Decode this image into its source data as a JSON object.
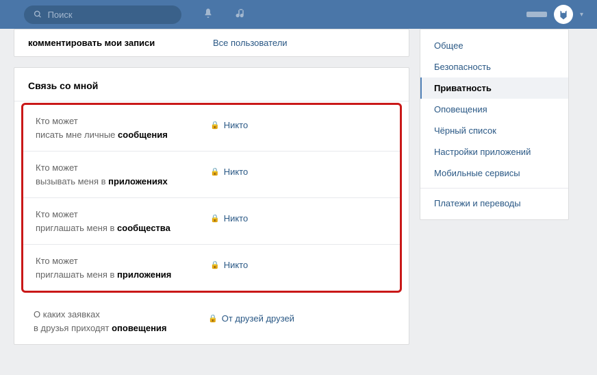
{
  "header": {
    "search_placeholder": "Поиск"
  },
  "overflow": {
    "label": "комментировать мои записи",
    "value": "Все пользователи"
  },
  "section": {
    "title": "Связь со мной"
  },
  "rows": [
    {
      "l1": "Кто может",
      "l2_pre": "писать мне личные ",
      "l2_bold": "сообщения",
      "value": "Никто"
    },
    {
      "l1": "Кто может",
      "l2_pre": "вызывать меня в ",
      "l2_bold": "приложениях",
      "value": "Никто"
    },
    {
      "l1": "Кто может",
      "l2_pre": "приглашать меня в ",
      "l2_bold": "сообщества",
      "value": "Никто"
    },
    {
      "l1": "Кто может",
      "l2_pre": "приглашать меня в ",
      "l2_bold": "приложения",
      "value": "Никто"
    }
  ],
  "bottom": {
    "l1": "О каких заявках",
    "l2_pre": "в друзья приходят ",
    "l2_bold": "оповещения",
    "value": "От друзей друзей"
  },
  "nav": {
    "items": [
      "Общее",
      "Безопасность",
      "Приватность",
      "Оповещения",
      "Чёрный список",
      "Настройки приложений",
      "Мобильные сервисы",
      "Платежи и переводы"
    ]
  }
}
